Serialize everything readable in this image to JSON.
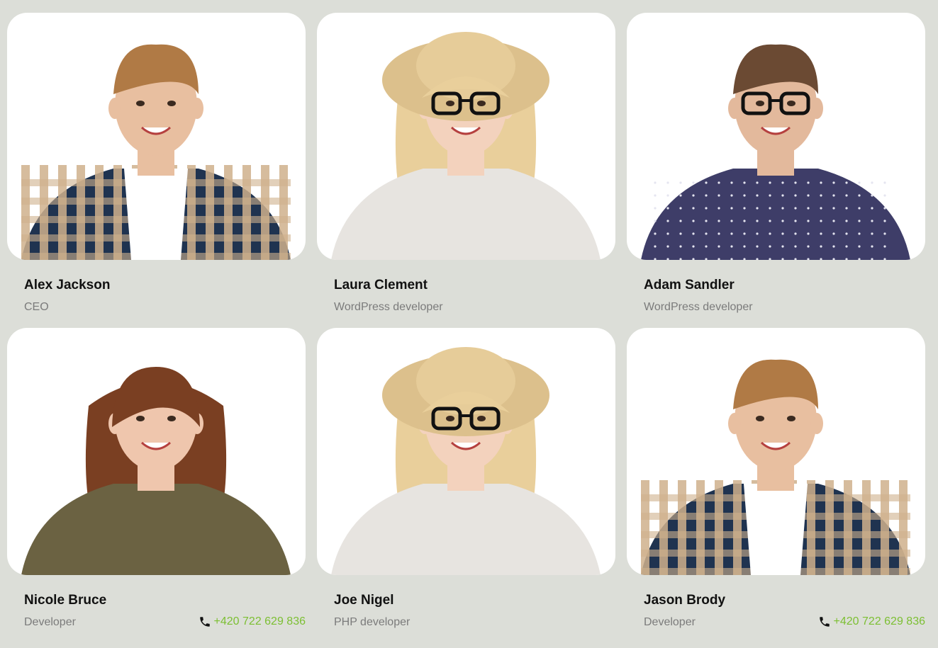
{
  "team": [
    {
      "name": "Alex Jackson",
      "role": "CEO",
      "phone": "",
      "photo": {
        "hair": "#b07a45",
        "skin": "#e8bfa0",
        "shirt": "plaid",
        "shirt_color": "#1f3350",
        "shirt_alt": "#cfb08c",
        "tee": "#ffffff",
        "glasses": false,
        "hat": false
      }
    },
    {
      "name": "Laura Clement",
      "role": "WordPress developer",
      "phone": "",
      "photo": {
        "hair": "#e9cf9b",
        "skin": "#f3d2bd",
        "shirt": "plain",
        "shirt_color": "#e7e4e0",
        "glasses": true,
        "hat": true
      }
    },
    {
      "name": "Adam Sandler",
      "role": "WordPress developer",
      "phone": "",
      "photo": {
        "hair": "#6b4a33",
        "skin": "#e3b99c",
        "shirt": "dotted",
        "shirt_color": "#3e3d68",
        "glasses": true,
        "hat": false
      }
    },
    {
      "name": "Nicole Bruce",
      "role": "Developer",
      "phone": "+420 722 629 836",
      "photo": {
        "hair": "#7a3f22",
        "skin": "#efc6ad",
        "shirt": "plain",
        "shirt_color": "#6b6242",
        "glasses": false,
        "hat": false,
        "long_hair": true
      }
    },
    {
      "name": "Joe Nigel",
      "role": "PHP developer",
      "phone": "",
      "photo": {
        "hair": "#e9cf9b",
        "skin": "#f3d2bd",
        "shirt": "plain",
        "shirt_color": "#e7e4e0",
        "glasses": true,
        "hat": true
      }
    },
    {
      "name": "Jason Brody",
      "role": "Developer",
      "phone": "+420 722 629 836",
      "photo": {
        "hair": "#b07a45",
        "skin": "#e8bfa0",
        "shirt": "plaid",
        "shirt_color": "#1f3350",
        "shirt_alt": "#cfb08c",
        "tee": "#ffffff",
        "glasses": false,
        "hat": false
      }
    }
  ],
  "phone_icon": "phone-icon",
  "colors": {
    "background": "#dcded8",
    "card": "#ffffff",
    "name": "#111111",
    "role": "#7b7b7b",
    "phone": "#7cbf32"
  }
}
